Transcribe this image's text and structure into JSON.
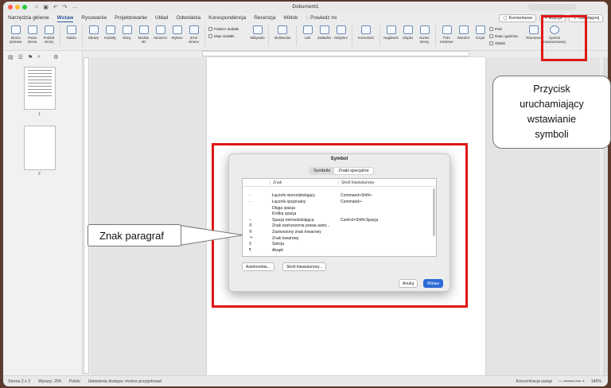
{
  "window": {
    "title": "Dokument1"
  },
  "ribbon_tabs": [
    "Narzędzia główne",
    "Wstaw",
    "Rysowanie",
    "Projektowanie",
    "Układ",
    "Odwołania",
    "Korespondencja",
    "Recenzja",
    "Widok",
    "Powiedz mi"
  ],
  "active_tab": "Wstaw",
  "tab_right": {
    "comments": "Komentarze",
    "edit": "Edycja",
    "share": "Udostępnij"
  },
  "ribbon_buttons": [
    "Strona tytułowa",
    "Pusta strona",
    "Podział strony",
    "Tabela",
    "Obrazy",
    "Kształty",
    "Ikony",
    "Modele 3D",
    "SmartArt",
    "Wykres",
    "Zrzut ekranu",
    "Wikipedia",
    "Multimedia",
    "Link",
    "Zakładka",
    "Odsyłacz",
    "Komentarz",
    "Nagłówek",
    "Stopka",
    "Numer strony",
    "Pole tekstowe",
    "WordArt",
    "Inicjał",
    "Równanie",
    "Symbol zaawansowany"
  ],
  "ribbon_small": {
    "addins_get": "Pobierz dodatki",
    "addins_my": "Moje dodatki",
    "field": "Pole",
    "datetime": "Data i godzina",
    "object": "Obiekt"
  },
  "thumbs": [
    "1",
    "2"
  ],
  "status": {
    "page": "Strona 2 z 2",
    "words": "Wyrazy: 204",
    "lang": "Polski",
    "access": "Ułatwienia dostępu: można przygotować",
    "focus": "Koncentracja uwagi",
    "zoom": "140%"
  },
  "dialog": {
    "title": "Symbol",
    "tabs": [
      "Symbole",
      "Znaki specjalne"
    ],
    "active_tab": "Znaki specjalne",
    "columns": [
      "Znak",
      "Skrót klawiaturowy"
    ],
    "rows": [
      {
        "glyph": "",
        "name": "",
        "shortcut": ""
      },
      {
        "glyph": "-",
        "name": "Łącznik nierozdzielający",
        "shortcut": "Command+Shift+-"
      },
      {
        "glyph": "-",
        "name": "Łącznik opcjonalny",
        "shortcut": "Command+-"
      },
      {
        "glyph": "",
        "name": "Długa spacja",
        "shortcut": ""
      },
      {
        "glyph": "",
        "name": "Krótka spacja",
        "shortcut": ""
      },
      {
        "glyph": "–",
        "name": "Spacja nierozdzielająca",
        "shortcut": "Control+Shift+Spacja"
      },
      {
        "glyph": "©",
        "name": "Znak zastrzeżenia prawa autor...",
        "shortcut": ""
      },
      {
        "glyph": "®",
        "name": "Zastrzeżony znak towarowy",
        "shortcut": ""
      },
      {
        "glyph": "™",
        "name": "Znak towarowy",
        "shortcut": ""
      },
      {
        "glyph": "§",
        "name": "Sekcja",
        "shortcut": ""
      },
      {
        "glyph": "¶",
        "name": "Akapit",
        "shortcut": ""
      }
    ],
    "autocorrect": "Autokorekta...",
    "shortcut_btn": "Skrót klawiaturowy...",
    "cancel": "Anuluj",
    "insert": "Wstaw"
  },
  "callouts": {
    "znak": "Znak paragraf",
    "przycisk": [
      "Przycisk",
      "uruchamiający",
      "wstawianie",
      "symboli"
    ]
  },
  "colors": {
    "highlight": "#e01818",
    "accent": "#2b579a",
    "primary_button": "#2c6bd8"
  }
}
